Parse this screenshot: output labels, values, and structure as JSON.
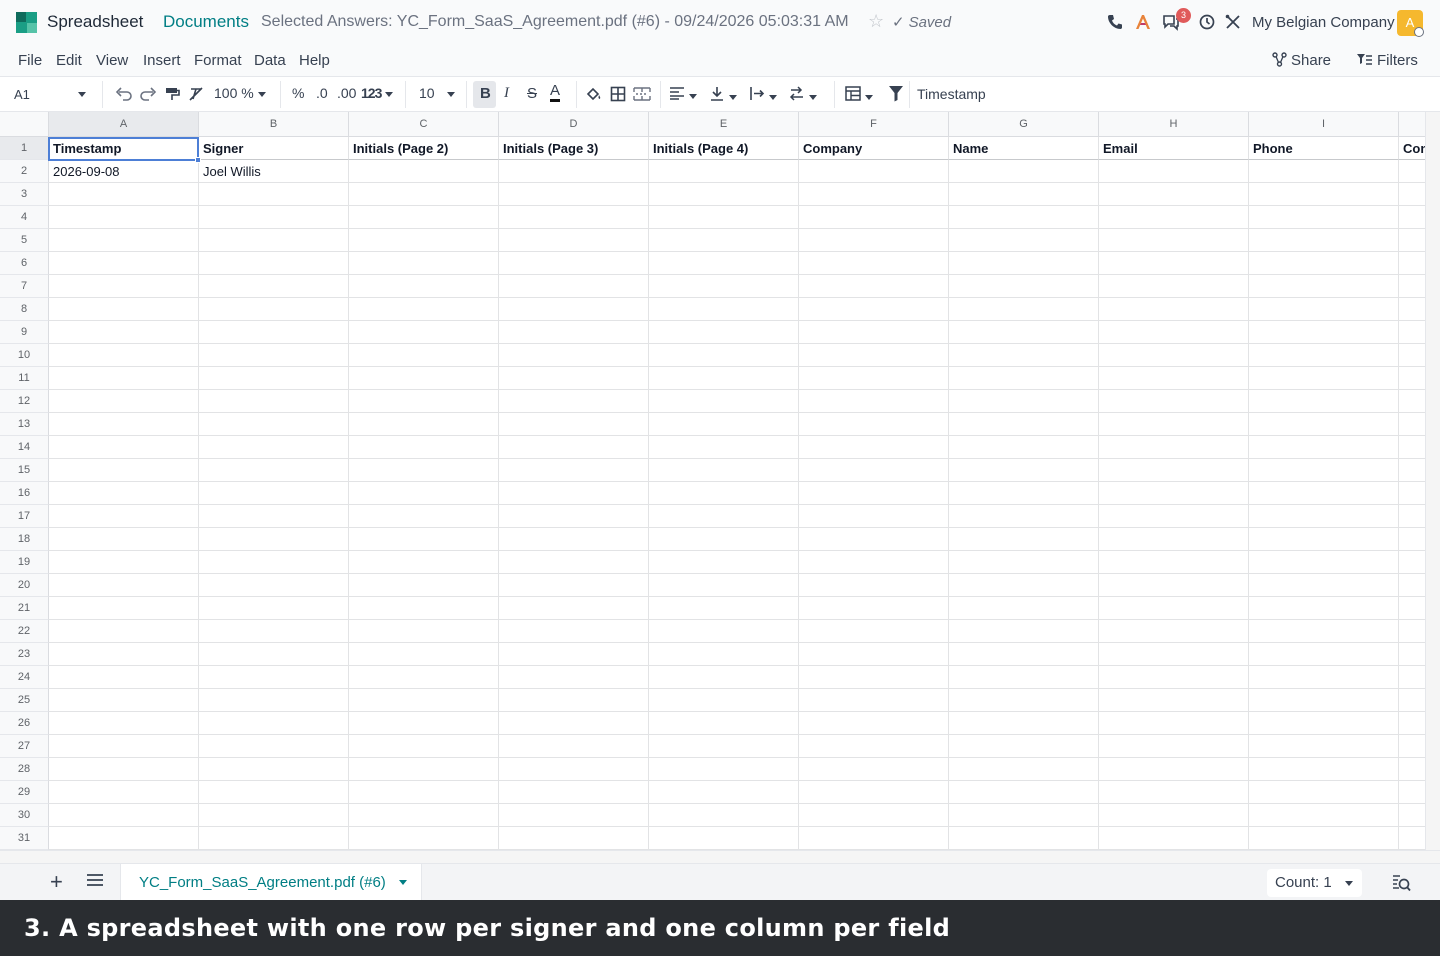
{
  "header": {
    "app_name": "Spreadsheet",
    "breadcrumb_docs": "Documents",
    "breadcrumb_title": "Selected Answers: YC_Form_SaaS_Agreement.pdf (#6) - 09/24/2026 05:03:31 AM",
    "saved_label": "Saved",
    "notification_count": "3",
    "company": "My Belgian Company",
    "avatar_letter": "A"
  },
  "menu": {
    "items": [
      "File",
      "Edit",
      "View",
      "Insert",
      "Format",
      "Data",
      "Help"
    ],
    "share_label": "Share",
    "filters_label": "Filters"
  },
  "toolbar": {
    "cell_ref": "A1",
    "zoom": "100 %",
    "percent": "%",
    "dec_decrease": ".0",
    "dec_increase": ".00",
    "number_format": "123",
    "font_size": "10",
    "formula_value": "Timestamp"
  },
  "sheet": {
    "columns": [
      "A",
      "B",
      "C",
      "D",
      "E",
      "F",
      "G",
      "H",
      "I",
      ""
    ],
    "row_count": 31,
    "headers": [
      "Timestamp",
      "Signer",
      "Initials (Page 2)",
      "Initials (Page 3)",
      "Initials (Page 4)",
      "Company",
      "Name",
      "Email",
      "Phone",
      "Con"
    ],
    "rows": [
      [
        "2026-09-08",
        "Joel Willis",
        "",
        "",
        "",
        "",
        "",
        "",
        "",
        ""
      ]
    ]
  },
  "bottom": {
    "sheet_tab": "YC_Form_SaaS_Agreement.pdf (#6)",
    "count_label": "Count: 1"
  },
  "caption": "3. A spreadsheet with one row per signer and one column per field",
  "colors": {
    "brand": "#017e84",
    "selection": "#4d7fd6",
    "badge": "#e05a5a",
    "avatar": "#f5b82e"
  }
}
